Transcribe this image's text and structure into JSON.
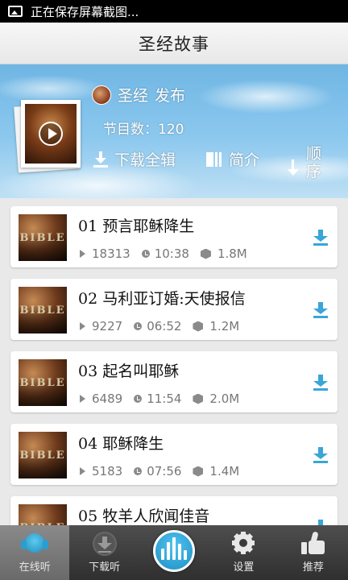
{
  "status_bar": {
    "text": "正在保存屏幕截图..."
  },
  "header": {
    "title": "圣经故事"
  },
  "album": {
    "publisher_name": "圣经",
    "publisher_label": "发布",
    "episode_count_label": "节目数：120",
    "download_all_label": "下载全辑",
    "intro_label": "简介",
    "order_label_line1": "顺",
    "order_label_line2": "序"
  },
  "episodes": [
    {
      "title": "01 预言耶稣降生",
      "plays": "18313",
      "duration": "10:38",
      "size": "1.8M"
    },
    {
      "title": "02 马利亚订婚:天使报信",
      "plays": "9227",
      "duration": "06:52",
      "size": "1.2M"
    },
    {
      "title": "03 起名叫耶稣",
      "plays": "6489",
      "duration": "11:54",
      "size": "2.0M"
    },
    {
      "title": "04 耶稣降生",
      "plays": "5183",
      "duration": "07:56",
      "size": "1.4M"
    },
    {
      "title": "05 牧羊人欣闻佳音",
      "plays": "",
      "duration": "",
      "size": ""
    }
  ],
  "thumb_text": "BIBLE",
  "bottom_nav": {
    "online": "在线听",
    "download": "下载听",
    "settings": "设置",
    "recommend": "推荐"
  },
  "colors": {
    "accent": "#3aa5d8",
    "nav_bg": "#3a3a3a"
  }
}
